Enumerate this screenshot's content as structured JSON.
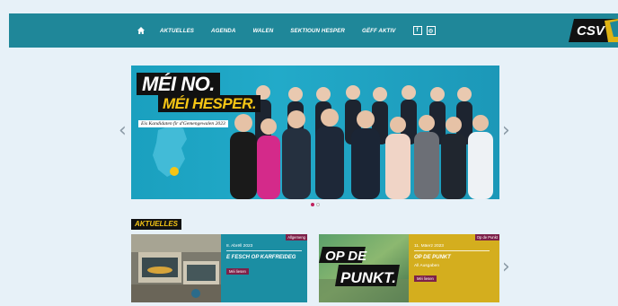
{
  "nav": {
    "items": [
      "AKTUELLES",
      "AGENDA",
      "WALEN",
      "SEKTIOUN HESPER",
      "GËFF AKTIV"
    ],
    "social": [
      "f",
      "◎"
    ]
  },
  "logo": {
    "text": "CSV"
  },
  "hero": {
    "line1": "MÉI NO.",
    "line2": "MÉI HESPER.",
    "line3": "Eis Kandidaten fir d'Gemengewalen 2023"
  },
  "carousel": {
    "prev": "‹",
    "next": "›",
    "slides": 2,
    "active": 0
  },
  "news": {
    "section_label": "AKTUELLES",
    "next": "›",
    "cards": [
      {
        "tag": "Allgemeng",
        "date": "8. Abrëll 2023",
        "title": "E FESCH OP KARFREIDEG",
        "subtitle": "",
        "button": "Méi liesen",
        "color": "#1b8ea3"
      },
      {
        "tag": "Op de Punkt",
        "date": "11. Mäerz 2023",
        "title": "OP DE PUNKT",
        "subtitle": "All Ausgaben",
        "button": "Méi liesen",
        "color": "#d4ae1e",
        "image_text_1": "OP DE",
        "image_text_2": "PUNKT."
      }
    ]
  },
  "colors": {
    "topbar": "#1f8799",
    "accent": "#f5c515",
    "magenta": "#7d2149",
    "background": "#e7f1f8"
  }
}
